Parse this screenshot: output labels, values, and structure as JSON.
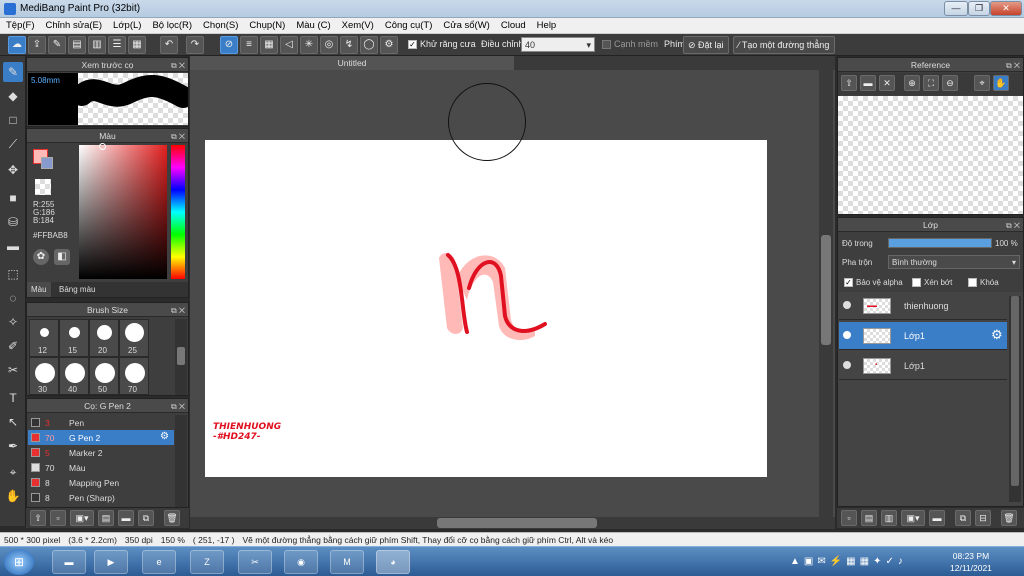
{
  "window": {
    "title": "MediBang Paint Pro (32bit)",
    "minimize": "—",
    "maximize": "❐",
    "close": "✕"
  },
  "menu": [
    "Tệp(F)",
    "Chỉnh sửa(E)",
    "Lớp(L)",
    "Bộ lọc(R)",
    "Chọn(S)",
    "Chụp(N)",
    "Màu (C)",
    "Xem(V)",
    "Công cụ(T)",
    "Cửa sổ(W)",
    "Cloud",
    "Help"
  ],
  "toolbar": {
    "antialias_label": "Khử răng cưa",
    "adjust_label": "Điều chỉnh",
    "adjust_value": "40",
    "edge_label": "Cạnh mềm",
    "key_label": "Phím",
    "reset_label": "Đặt lại",
    "straight_line_label": "Tạo một đường thẳng"
  },
  "brush_preview": {
    "title": "Xem trước cọ",
    "size": "5.08mm"
  },
  "color_panel": {
    "title": "Màu",
    "r": "R:255",
    "g": "G:186",
    "b": "B:184",
    "hex": "#FFBAB8",
    "tab_color": "Màu",
    "tab_palette": "Bảng màu",
    "primary_color": "#ffbab8"
  },
  "brush_size": {
    "title": "Brush Size",
    "sizes": [
      "12",
      "15",
      "20",
      "25",
      "30",
      "40",
      "50",
      "70"
    ]
  },
  "brush_list": {
    "title": "Cọ: G Pen 2",
    "items": [
      {
        "size": "3",
        "name": "Pen",
        "color": "#333333"
      },
      {
        "size": "70",
        "name": "G Pen 2",
        "color": "#e83030"
      },
      {
        "size": "5",
        "name": "Marker 2",
        "color": "#e83030"
      },
      {
        "size": "70",
        "name": "Màu",
        "color": "#dddddd"
      },
      {
        "size": "8",
        "name": "Mapping Pen",
        "color": "#e83030"
      },
      {
        "size": "8",
        "name": "Pen (Sharp)",
        "color": "#333333"
      }
    ]
  },
  "canvas": {
    "tab_title": "Untitled",
    "signature_line1": "THIENHUONG",
    "signature_line2": "-#HD247-",
    "stroke_color": "#e01020",
    "fill_color": "#ffbab8"
  },
  "reference": {
    "title": "Reference"
  },
  "layers": {
    "title": "Lớp",
    "opacity_label": "Độ trong",
    "opacity_value": "100 %",
    "opacity_fraction": 1.0,
    "blend_label": "Pha trộn",
    "blend_value": "Bình thường",
    "protect_alpha": "Bảo vệ alpha",
    "clip": "Xén bớt",
    "lock": "Khóa",
    "items": [
      {
        "name": "thienhuong"
      },
      {
        "name": "Lớp1"
      },
      {
        "name": "Lớp1"
      }
    ]
  },
  "status": {
    "pixels": "500 * 300 pixel",
    "size_cm": "(3.6 * 2.2cm)",
    "dpi": "350 dpi",
    "zoom": "150 %",
    "coords": "( 251, -17 )",
    "hint": "Vẽ một đường thẳng bằng cách giữ phím Shift, Thay đổi cỡ cọ bằng cách giữ phím Ctrl, Alt và kéo"
  },
  "taskbar": {
    "time": "08:23 PM",
    "date": "12/11/2021",
    "apps": [
      "Start",
      "Explorer",
      "Media",
      "IE",
      "Zalo",
      "Paint",
      "Chrome",
      "MediBang",
      "Colors"
    ]
  }
}
